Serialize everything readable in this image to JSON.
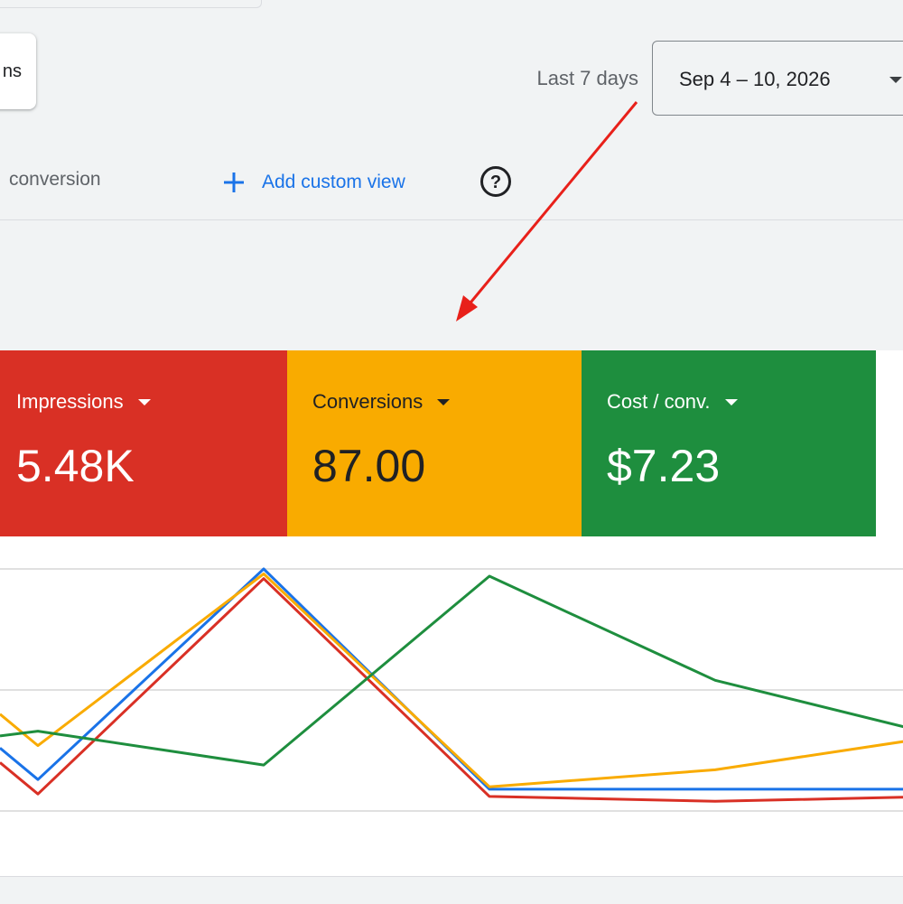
{
  "partial_button": {
    "label": "ns"
  },
  "date_range": {
    "label": "Last 7 days",
    "value": "Sep 4 – 10, 2026"
  },
  "views": {
    "current_tab": "conversion",
    "add_custom_view": "Add custom view"
  },
  "metrics": [
    {
      "name": "Impressions",
      "value": "5.48K",
      "color": "#d93025",
      "text_color": "#ffffff"
    },
    {
      "name": "Conversions",
      "value": "87.00",
      "color": "#f9ab00",
      "text_color": "#202124"
    },
    {
      "name": "Cost / conv.",
      "value": "$7.23",
      "color": "#1e8e3e",
      "text_color": "#ffffff"
    }
  ],
  "annotation": {
    "arrow_color": "#e8201a"
  },
  "chart_data": {
    "type": "line",
    "x": [
      0,
      1,
      2,
      3,
      4,
      5,
      6
    ],
    "y_normalized_range": [
      0,
      1
    ],
    "grid": true,
    "series": [
      {
        "color": "#d93025",
        "values": [
          0.2,
          0.07,
          0.96,
          0.06,
          0.04,
          0.06,
          0.06
        ]
      },
      {
        "color": "#1a73e8",
        "values": [
          0.26,
          0.13,
          1.0,
          0.09,
          0.09,
          0.09,
          0.09
        ]
      },
      {
        "color": "#f9ab00",
        "values": [
          0.4,
          0.27,
          0.98,
          0.1,
          0.17,
          0.31,
          0.31
        ]
      },
      {
        "color": "#1e8e3e",
        "values": [
          0.31,
          0.33,
          0.19,
          0.97,
          0.54,
          0.31,
          0.31
        ]
      }
    ]
  }
}
